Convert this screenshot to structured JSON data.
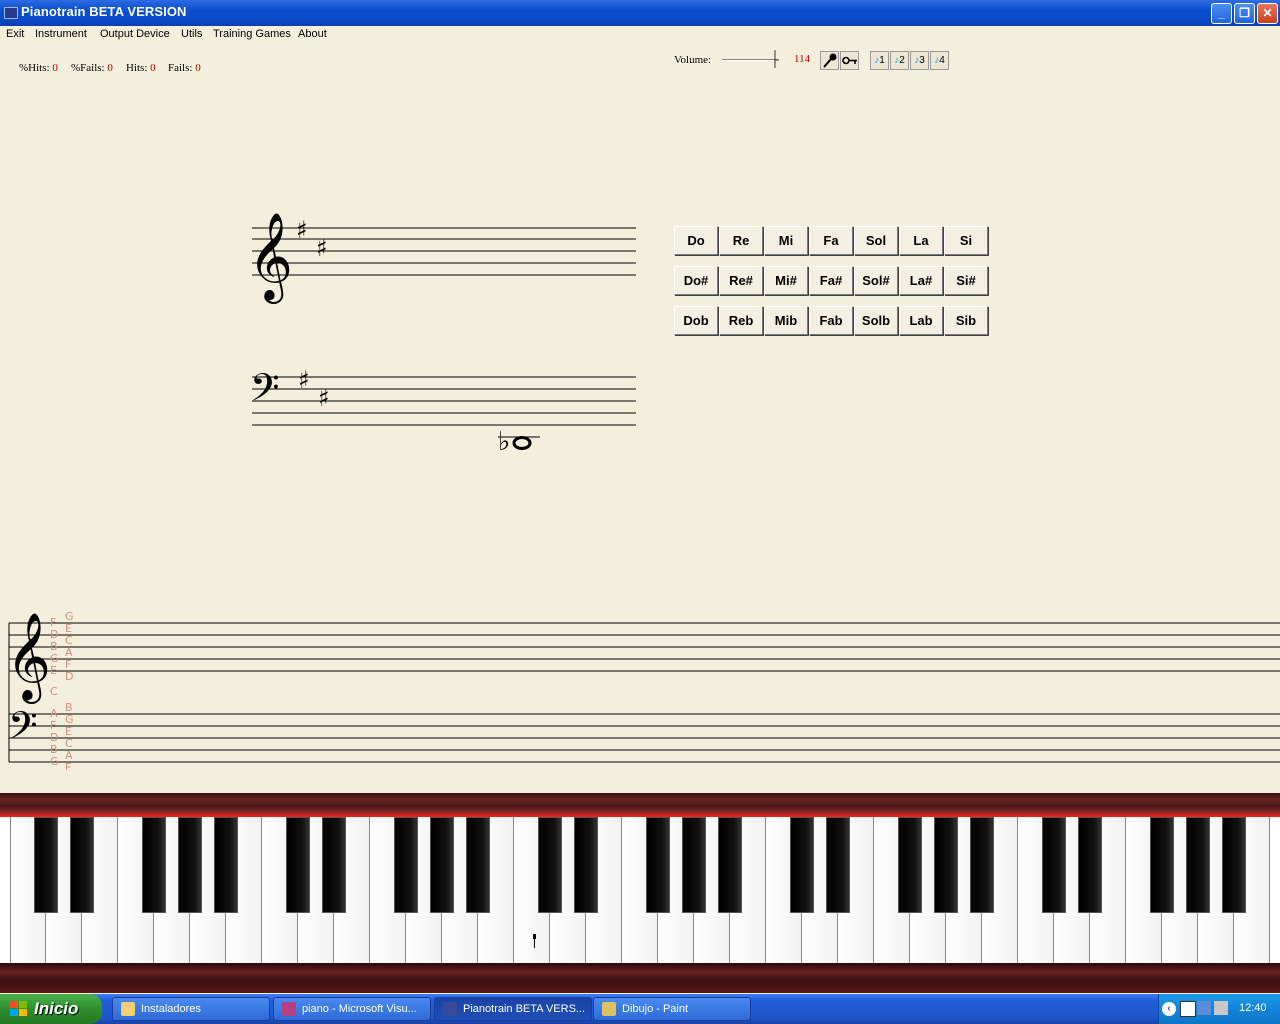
{
  "window": {
    "title": "Pianotrain BETA VERSION",
    "controls": {
      "minimize": "_",
      "restore": "❐",
      "close": "✕"
    }
  },
  "menu": {
    "items": [
      "Exit",
      "Instrument",
      "Output Device",
      "Utils",
      "Training Games",
      "About"
    ]
  },
  "stats": {
    "pct_hits_label": "%Hits:",
    "pct_hits_value": "0",
    "pct_fails_label": "%Fails:",
    "pct_fails_value": "0",
    "hits_label": "Hits:",
    "hits_value": "0",
    "fails_label": "Fails:",
    "fails_value": "0"
  },
  "toolbar": {
    "volume_label": "Volume:",
    "volume_value": "114",
    "mode_buttons": [
      "1",
      "2",
      "3",
      "4"
    ]
  },
  "note_buttons": {
    "naturals": [
      "Do",
      "Re",
      "Mi",
      "Fa",
      "Sol",
      "La",
      "Si"
    ],
    "sharps": [
      "Do#",
      "Re#",
      "Mi#",
      "Fa#",
      "Sol#",
      "La#",
      "Si#"
    ],
    "flats": [
      "Dob",
      "Reb",
      "Mib",
      "Fab",
      "Solb",
      "Lab",
      "Sib"
    ]
  },
  "guide_labels": {
    "treble_col1": [
      "F",
      "D",
      "B",
      "G",
      "E"
    ],
    "treble_col2": [
      "G",
      "E",
      "C",
      "A",
      "F",
      "D"
    ],
    "middle": "C",
    "bass_col1": [
      "A",
      "F",
      "D",
      "B",
      "G"
    ],
    "bass_col2": [
      "B",
      "G",
      "E",
      "C",
      "A",
      "F"
    ]
  },
  "colors": {
    "background": "#f4efdc",
    "accent_red": "#c00000",
    "guide_letters": "#d09080"
  },
  "taskbar": {
    "start_label": "Inicio",
    "tasks": [
      {
        "label": "Instaladores",
        "icon": "folder-icon"
      },
      {
        "label": "piano - Microsoft Visu...",
        "icon": "visual-studio-icon"
      },
      {
        "label": "Pianotrain BETA VERS...",
        "icon": "pianotrain-icon",
        "active": true
      },
      {
        "label": "Dibujo - Paint",
        "icon": "paint-icon"
      }
    ],
    "clock": "12:40"
  }
}
